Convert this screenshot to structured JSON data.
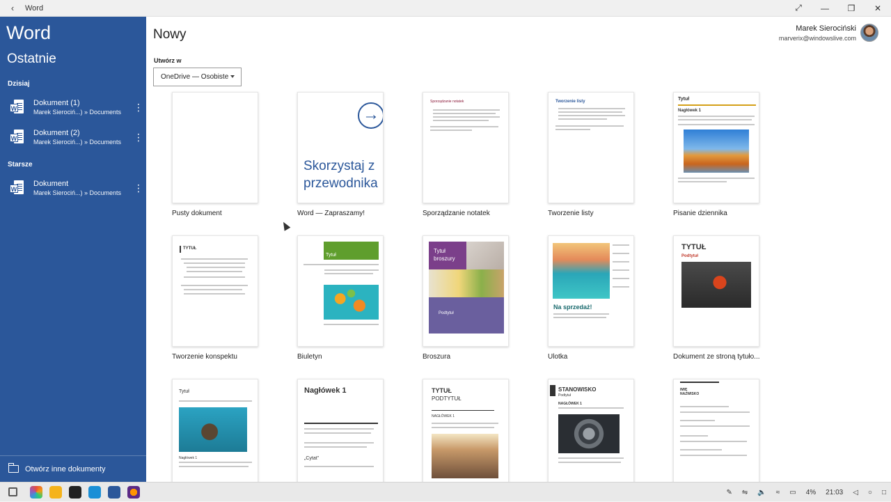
{
  "window": {
    "title": "Word"
  },
  "sidebar": {
    "app_name": "Word",
    "section_title": "Ostatnie",
    "groups": [
      {
        "label": "Dzisiaj",
        "docs": [
          {
            "name": "Dokument (1)",
            "path": "Marek Sierociń...) » Documents"
          },
          {
            "name": "Dokument (2)",
            "path": "Marek Sierociń...) » Documents"
          }
        ]
      },
      {
        "label": "Starsze",
        "docs": [
          {
            "name": "Dokument",
            "path": "Marek Sierociń...) » Documents"
          }
        ]
      }
    ],
    "open_other": "Otwórz inne dokumenty"
  },
  "main": {
    "title": "Nowy",
    "create_in_label": "Utwórz w",
    "location": "OneDrive — Osobiste",
    "templates": [
      "Pusty dokument",
      "Word — Zapraszamy!",
      "Sporządzanie notatek",
      "Tworzenie listy",
      "Pisanie dziennika",
      "Tworzenie konspektu",
      "Biuletyn",
      "Broszura",
      "Ulotka",
      "Dokument ze stroną tytuło..."
    ],
    "thumb_text": {
      "welcome_line1": "Skorzystaj z",
      "welcome_line2": "przewodnika",
      "notes_title": "Sporządzanie notatek",
      "list_title": "Tworzenie listy",
      "journal_title": "Tytuł",
      "journal_head": "Nagłówek 1",
      "outline_title": "TYTUŁ",
      "newsletter_title": "Tytuł",
      "brochure_title1": "Tytuł",
      "brochure_title2": "broszury",
      "brochure_sub": "Podtytuł",
      "flyer_title": "Na sprzedaż!",
      "cover_title": "TYTUŁ",
      "cover_sub": "Podtytuł",
      "r3_1_title": "Tytuł",
      "r3_1_head": "Nagłówek 1",
      "r3_2_head": "Nagłówek 1",
      "r3_2_quote": "„Cytat”",
      "r3_3_title": "TYTUŁ",
      "r3_3_sub": "PODTYTUŁ",
      "r3_3_head": "NAGŁÓWEK 1",
      "r3_4_title": "STANOWISKO",
      "r3_4_sub": "Podtytuł",
      "r3_4_head": "NAGŁÓWEK 1",
      "r3_5_title": "IMIĘ",
      "r3_5_sub": "NAZWISKO"
    }
  },
  "user": {
    "name": "Marek Sierociński",
    "email": "marverix@windowslive.com"
  },
  "taskbar": {
    "battery": "4%",
    "clock": "21:03"
  }
}
